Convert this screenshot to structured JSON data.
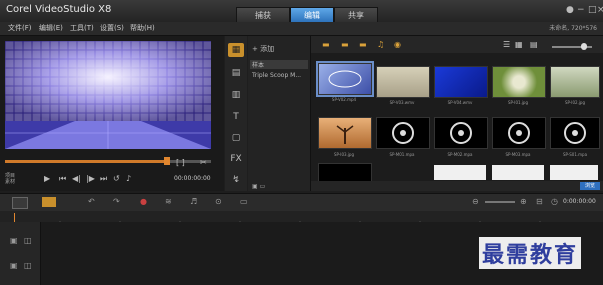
{
  "app_title": "Corel VideoStudio X8",
  "step_tabs": [
    {
      "label": "捕获",
      "active": false
    },
    {
      "label": "编辑",
      "active": true
    },
    {
      "label": "共享",
      "active": false
    }
  ],
  "menu": [
    "文件(F)",
    "编辑(E)",
    "工具(T)",
    "设置(S)",
    "帮助(H)"
  ],
  "project_name": "未命名, 720*576",
  "preview": {
    "mode_labels": [
      "项目",
      "素材"
    ],
    "timecode": "00:00:00:00"
  },
  "gallery": {
    "add_label": "添加",
    "items": [
      "样本",
      "Triple Scoop M..."
    ],
    "browse_label": "浏览"
  },
  "library_thumbs": [
    {
      "label": "SP-V02.mp4",
      "selected": true
    },
    {
      "label": "SP-V03.wmv"
    },
    {
      "label": "SP-V04.wmv"
    },
    {
      "label": "SP-I01.jpg"
    },
    {
      "label": "SP-I02.jpg"
    },
    {
      "label": "SP-I03.jpg"
    },
    {
      "label": "SP-M01.mpa"
    },
    {
      "label": "SP-M02.mpa"
    },
    {
      "label": "SP-M03.mpa"
    },
    {
      "label": "SP-S01.mpa"
    }
  ],
  "timeline": {
    "timecode": "0:00:00:00"
  },
  "watermark": "最需教育",
  "colors": {
    "accent": "#2a6fb8",
    "scrub": "#d07a2a",
    "selected_tool": "#c9902c"
  }
}
